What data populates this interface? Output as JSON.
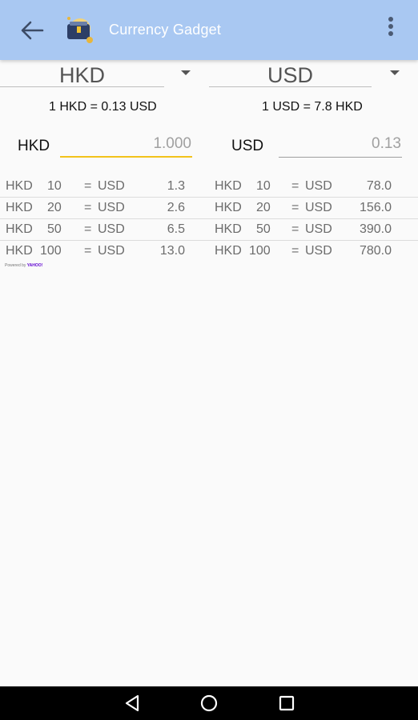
{
  "app": {
    "title": "Currency Gadget"
  },
  "icons": {
    "back": "arrow-left",
    "app": "wallet-globe",
    "overflow": "three-dots-vertical",
    "nav_back": "triangle-back",
    "nav_home": "circle-home",
    "nav_recent": "square-recents"
  },
  "colors": {
    "appbar": "#a9c8f2",
    "accent_underline": "#f2c21b"
  },
  "left": {
    "currency": "HKD",
    "rate": "1 HKD = 0.13 USD",
    "label": "HKD",
    "value": "1.000"
  },
  "right": {
    "currency": "USD",
    "rate": "1 USD = 7.8 HKD",
    "label": "USD",
    "value": "0.13"
  },
  "conversions": [
    {
      "lf": "HKD",
      "la": "10",
      "leq": "=",
      "lt": "USD",
      "lr": "1.3",
      "rf": "HKD",
      "ra": "10",
      "req": "=",
      "rt": "USD",
      "rr": "78.0"
    },
    {
      "lf": "HKD",
      "la": "20",
      "leq": "=",
      "lt": "USD",
      "lr": "2.6",
      "rf": "HKD",
      "ra": "20",
      "req": "=",
      "rt": "USD",
      "rr": "156.0"
    },
    {
      "lf": "HKD",
      "la": "50",
      "leq": "=",
      "lt": "USD",
      "lr": "6.5",
      "rf": "HKD",
      "ra": "50",
      "req": "=",
      "rt": "USD",
      "rr": "390.0"
    },
    {
      "lf": "HKD",
      "la": "100",
      "leq": "=",
      "lt": "USD",
      "lr": "13.0",
      "rf": "HKD",
      "ra": "100",
      "req": "=",
      "rt": "USD",
      "rr": "780.0"
    }
  ],
  "attribution": {
    "prefix": "Powered by",
    "brand": "YAHOO!"
  }
}
